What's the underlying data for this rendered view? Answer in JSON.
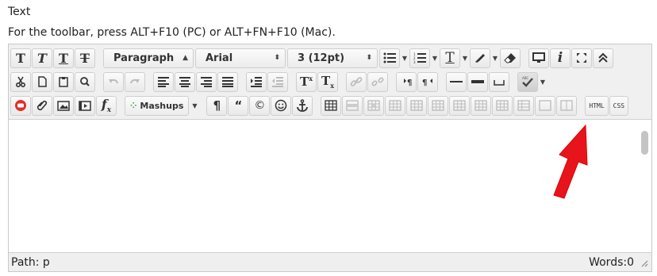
{
  "field_label": "Text",
  "hint": "For the toolbar, press ALT+F10 (PC) or ALT+FN+F10 (Mac).",
  "toolbar": {
    "row1": {
      "format_select": "Paragraph",
      "font_select": "Arial",
      "size_select": "3 (12pt)"
    },
    "row3": {
      "mashups_label": "Mashups",
      "html_label": "HTML",
      "css_label": "CSS"
    }
  },
  "status": {
    "path_label": "Path: p",
    "words_label": "Words:0"
  },
  "colors": {
    "toolbar_bg": "#f0f0f0",
    "arrow": "#e8141b",
    "youtube": "#e52d27"
  }
}
